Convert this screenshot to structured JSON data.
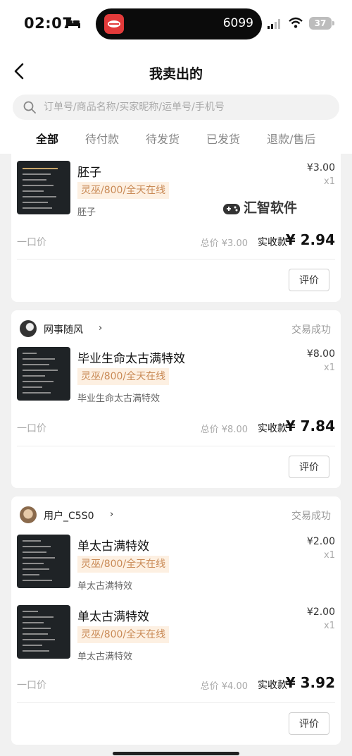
{
  "status_bar": {
    "time": "02:07",
    "island_count": "6099",
    "battery": "37"
  },
  "header": {
    "title": "我卖出的",
    "search_placeholder": "订单号/商品名称/买家昵称/运单号/手机号",
    "tabs": [
      {
        "label": "全部",
        "active": true
      },
      {
        "label": "待付款",
        "active": false
      },
      {
        "label": "待发货",
        "active": false
      },
      {
        "label": "已发货",
        "active": false
      },
      {
        "label": "退款/售后",
        "active": false
      }
    ]
  },
  "watermark": "汇智软件",
  "orders": [
    {
      "items": [
        {
          "title": "胚子",
          "tag": "灵巫/800/全天在线",
          "subtitle": "胚子",
          "price": "¥3.00",
          "qty": "x1"
        }
      ],
      "price_type": "一口价",
      "total": "总价 ¥3.00",
      "paid_label": "实收款",
      "paid_amount": "¥ 2.94",
      "review_label": "评价"
    },
    {
      "seller": "网事随风",
      "status": "交易成功",
      "items": [
        {
          "title": "毕业生命太古满特效",
          "tag": "灵巫/800/全天在线",
          "subtitle": "毕业生命太古满特效",
          "price": "¥8.00",
          "qty": "x1"
        }
      ],
      "price_type": "一口价",
      "total": "总价 ¥8.00",
      "paid_label": "实收款",
      "paid_amount": "¥ 7.84",
      "review_label": "评价"
    },
    {
      "seller": "用户_C5S0",
      "status": "交易成功",
      "items": [
        {
          "title": "单太古满特效",
          "tag": "灵巫/800/全天在线",
          "subtitle": "单太古满特效",
          "price": "¥2.00",
          "qty": "x1"
        },
        {
          "title": "单太古满特效",
          "tag": "灵巫/800/全天在线",
          "subtitle": "单太古满特效",
          "price": "¥2.00",
          "qty": "x1"
        }
      ],
      "price_type": "一口价",
      "total": "总价 ¥4.00",
      "paid_label": "实收款",
      "paid_amount": "¥ 3.92",
      "review_label": "评价"
    }
  ],
  "colors": {
    "tag_bg": "#fdf0e2",
    "tag_text": "#c98a56",
    "page_bg": "#f1f1f1"
  },
  "icons": [
    "bed-icon",
    "signal-icon",
    "wifi-icon",
    "battery-icon",
    "back-arrow-icon",
    "search-icon",
    "chevron-right-icon",
    "gamepad-icon"
  ]
}
